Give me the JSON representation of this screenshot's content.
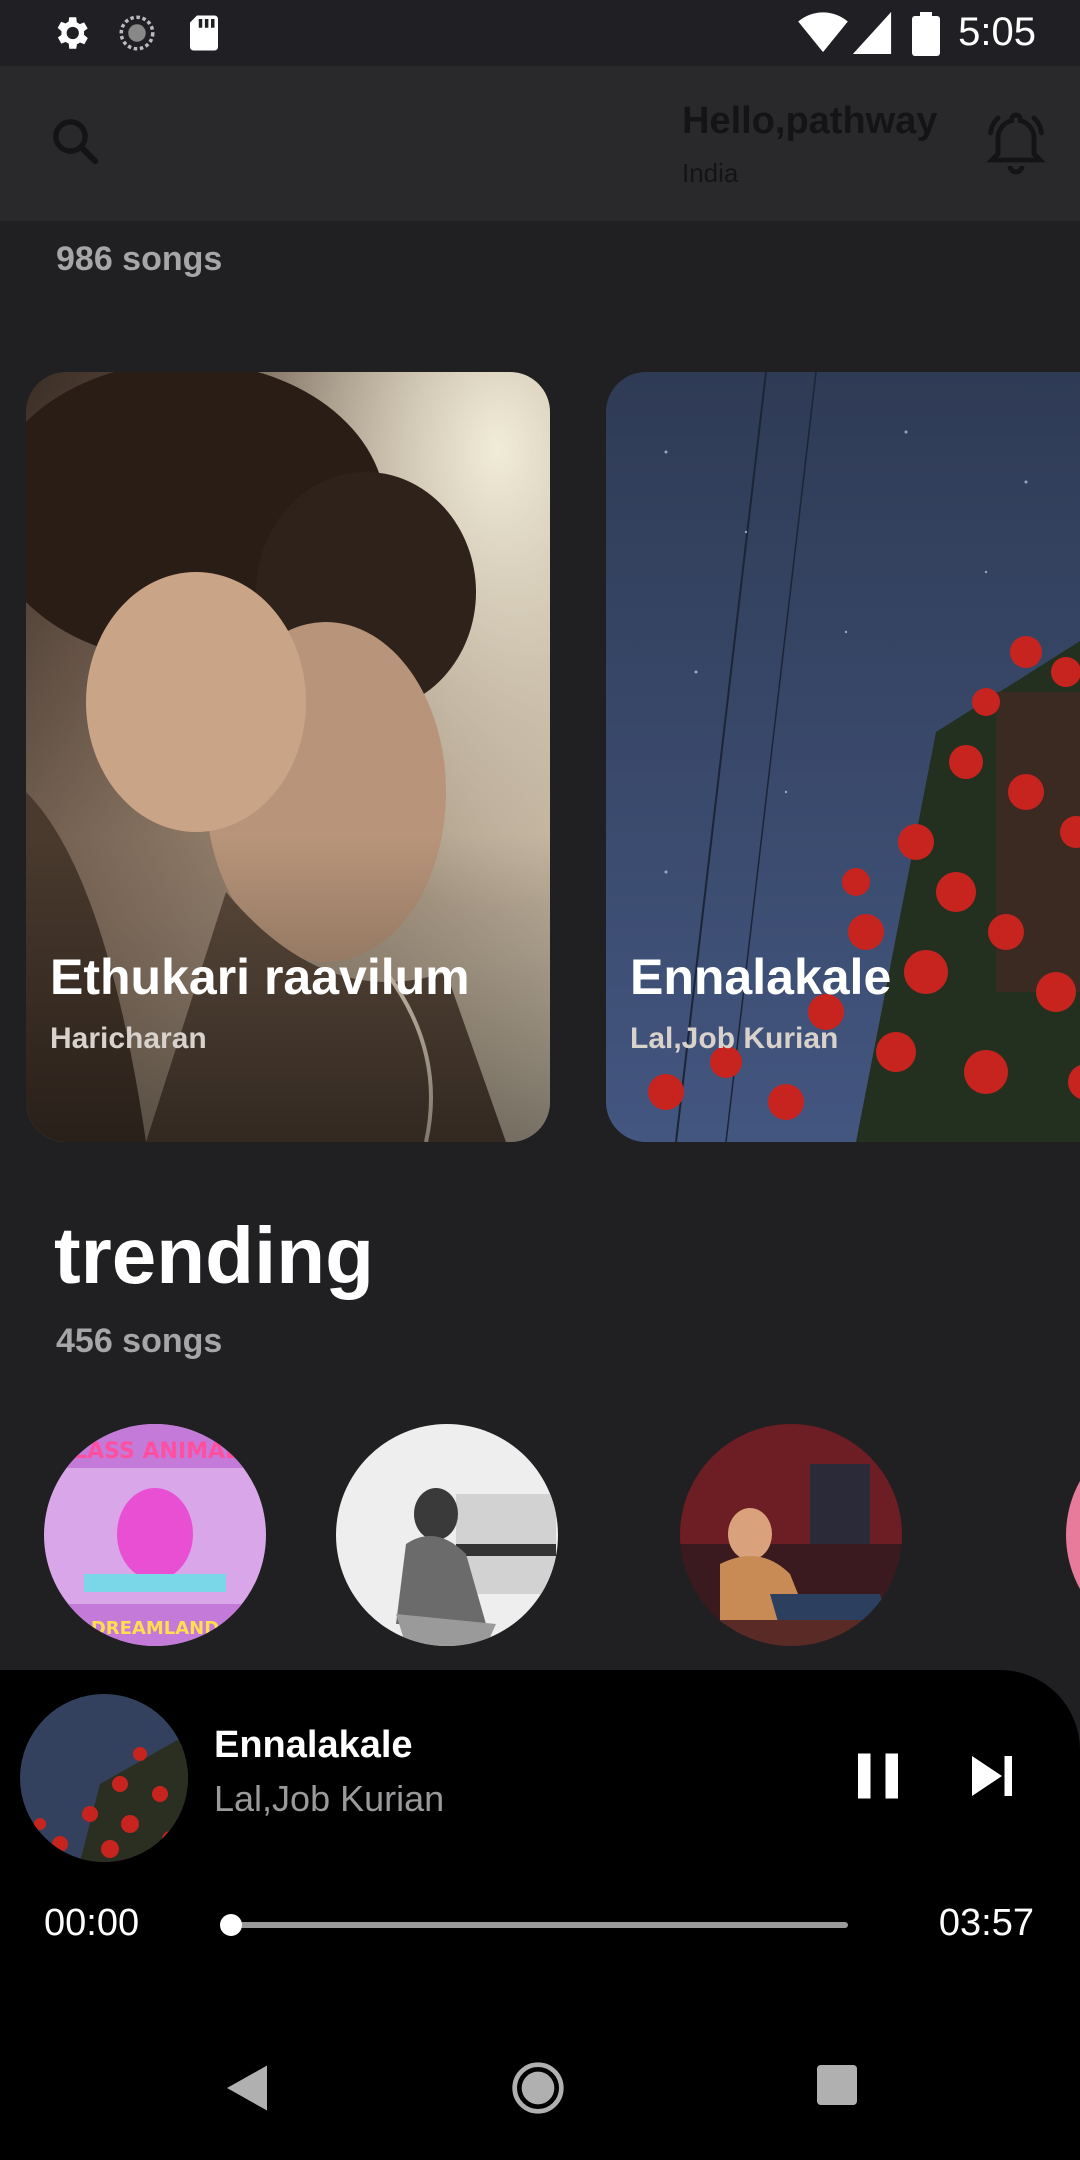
{
  "status_bar": {
    "time": "5:05",
    "icons": [
      "gear-icon",
      "sync-icon",
      "sd-card-icon",
      "wifi-icon",
      "signal-icon",
      "battery-icon"
    ]
  },
  "header": {
    "greeting": "Hello,pathway",
    "location": "India",
    "search_icon": "search-icon",
    "notification_icon": "bell-icon"
  },
  "featured": {
    "song_count": "986 songs",
    "cards": [
      {
        "title": "Ethukari raavilum",
        "artist": "Haricharan"
      },
      {
        "title": "Ennalakale",
        "artist": "Lal,Job Kurian"
      }
    ]
  },
  "trending": {
    "title": "trending",
    "song_count": "456 songs",
    "album_art_text": "GLASS ANIMALS",
    "album_art_subtext": "DREAMLAND"
  },
  "player": {
    "title": "Ennalakale",
    "artist": "Lal,Job Kurian",
    "elapsed": "00:00",
    "duration": "03:57",
    "progress": 0,
    "controls": [
      "pause-icon",
      "skip-next-icon"
    ]
  },
  "nav_bar": {
    "buttons": [
      "back-icon",
      "home-icon",
      "recents-icon"
    ]
  },
  "colors": {
    "background": "#202022",
    "app_bar": "#29292c",
    "player": "#000000",
    "muted_text": "#a6a6a8",
    "progress_track": "#9a9a9a"
  }
}
